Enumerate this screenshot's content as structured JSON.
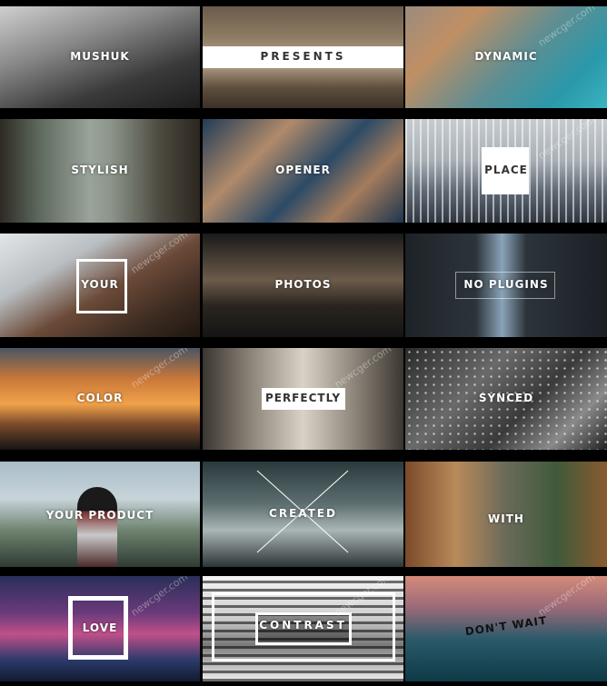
{
  "tiles": [
    {
      "caption": "MUSHUK",
      "bg": "linear-gradient(160deg,#cfcfcf 0%,#8a8a8a 35%,#3a3a3a 70%,#1c1c1c 100%)"
    },
    {
      "caption": "PRESENTS",
      "bg": "linear-gradient(180deg,#6b5b4a 0%,#8e7b64 30%,#b9a88f 55%,#5e4e3c 80%,#3c3128 100%)"
    },
    {
      "caption": "DYNAMIC",
      "bg": "linear-gradient(135deg,#9a8c7e 0%,#c08f64 25%,#5e8e93 55%,#2a98aa 80%,#3ab4c0 100%)"
    },
    {
      "caption": "STYLISH",
      "bg": "linear-gradient(90deg,#2d2a23 0%,#5f6a5e 20%,#9aa39a 45%,#8d968b 55%,#4d4a40 80%,#2b2720 100%)"
    },
    {
      "caption": "OPENER",
      "bg": "linear-gradient(135deg,#223b57 0%,#b08a6a 30%,#2c4a66 55%,#a47c5c 75%,#1d3550 100%)"
    },
    {
      "caption": "PLACE",
      "bg": "linear-gradient(180deg,#c7ccd0 0%,#a8b0b6 40%,#5e6873 70%,#2e3640 100%)"
    },
    {
      "caption": "YOUR",
      "bg": "linear-gradient(150deg,#e3e6e8 0%,#b9bec2 30%,#6b4a38 55%,#3a2a20 80%,#1f1712 100%)"
    },
    {
      "caption": "PHOTOS",
      "bg": "linear-gradient(180deg,#1a1a1a 0%,#6b5b4a 45%,#2a241e 70%,#151515 100%)"
    },
    {
      "caption": "NO PLUGINS",
      "bg": "linear-gradient(90deg,#1d2227 0%,#2c343b 35%,#8aa3b8 48%,#2c343b 60%,#1a1f24 100%)"
    },
    {
      "caption": "COLOR",
      "bg": "linear-gradient(180deg,#4a5564 0%,#c9773a 30%,#f1a24a 55%,#7a4a2a 75%,#151515 100%)"
    },
    {
      "caption": "PERFECTLY",
      "bg": "linear-gradient(90deg,#3a3631 0%,#8f877c 25%,#d9d2c6 50%,#8f877c 75%,#3a3631 100%)"
    },
    {
      "caption": "SYNCED",
      "bg": "linear-gradient(135deg,#2a2a2a 0%,#6a6a6a 35%,#3a3a3a 60%,#8a8a8a 80%,#222 100%)"
    },
    {
      "caption": "YOUR PRODUCT",
      "bg": "linear-gradient(180deg,#a8bcc6 0%,#c8d4da 35%,#6f8470 65%,#2f3b33 100%)"
    },
    {
      "caption": "CREATED",
      "bg": "linear-gradient(180deg,#2a3a3c 0%,#5d6e70 40%,#aab6b6 65%,#2c3436 100%)"
    },
    {
      "caption": "WITH",
      "bg": "linear-gradient(90deg,#7a4a2a 0%,#b98a5a 25%,#6a6a5a 50%,#3f5a3a 75%,#8a5a30 100%)"
    },
    {
      "caption": "LOVE",
      "bg": "linear-gradient(180deg,#2a2f5a 0%,#6a3a7a 35%,#c0508a 55%,#2a3a6a 80%,#121a30 100%)"
    },
    {
      "caption": "CONTRAST",
      "bg": "linear-gradient(180deg,#f4f4f4 0%,#cfcfcf 40%,#7a7a7a 65%,#f0f0f0 100%)"
    },
    {
      "caption": "DON'T WAIT",
      "bg": "linear-gradient(180deg,#d48a7a 0%,#9a6a78 30%,#2a5a6a 60%,#0f3a48 100%)"
    }
  ],
  "watermark": "newcger.com"
}
